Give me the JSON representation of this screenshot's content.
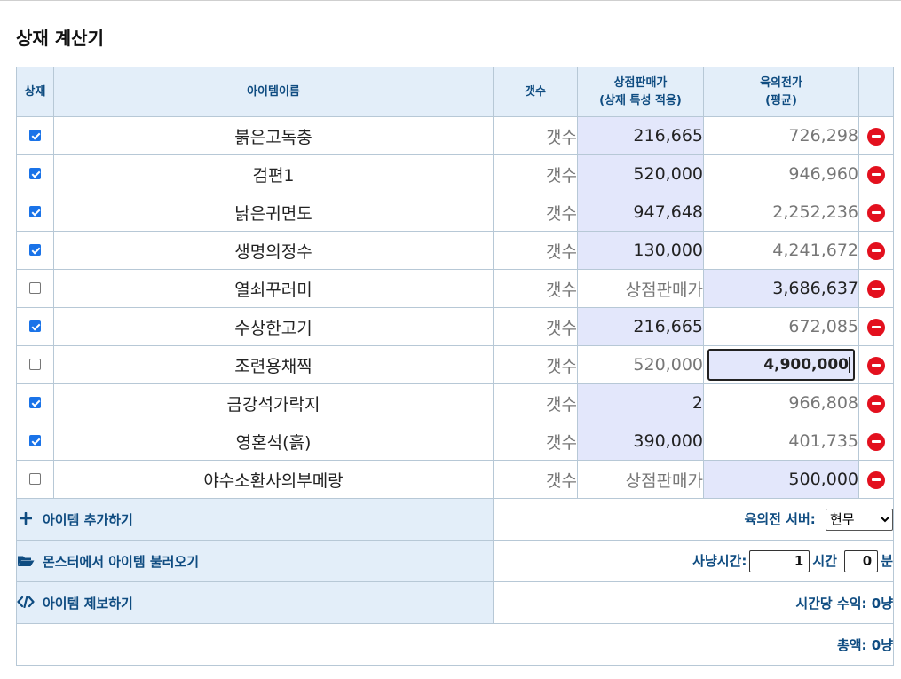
{
  "title": "상재 계산기",
  "headers": {
    "check": "상재",
    "name": "아이템이름",
    "qty": "갯수",
    "shop_line1": "상점판매가",
    "shop_line2": "(상재 특성 적용)",
    "market_line1": "육의전가",
    "market_line2": "(평균)"
  },
  "rows": [
    {
      "checked": true,
      "name": "붉은고독충",
      "qty_placeholder": "갯수",
      "shop": "216,665",
      "market": "726,298",
      "active": "shop"
    },
    {
      "checked": true,
      "name": "검편1",
      "qty_placeholder": "갯수",
      "shop": "520,000",
      "market": "946,960",
      "active": "shop"
    },
    {
      "checked": true,
      "name": "낡은귀면도",
      "qty_placeholder": "갯수",
      "shop": "947,648",
      "market": "2,252,236",
      "active": "shop"
    },
    {
      "checked": true,
      "name": "생명의정수",
      "qty_placeholder": "갯수",
      "shop": "130,000",
      "market": "4,241,672",
      "active": "shop"
    },
    {
      "checked": false,
      "name": "열쇠꾸러미",
      "qty_placeholder": "갯수",
      "shop": "상점판매가",
      "market": "3,686,637",
      "active": "market"
    },
    {
      "checked": true,
      "name": "수상한고기",
      "qty_placeholder": "갯수",
      "shop": "216,665",
      "market": "672,085",
      "active": "shop"
    },
    {
      "checked": false,
      "name": "조련용채찍",
      "qty_placeholder": "갯수",
      "shop": "520,000",
      "market": "4,900,000",
      "active": "market"
    },
    {
      "checked": true,
      "name": "금강석가락지",
      "qty_placeholder": "갯수",
      "shop": "2",
      "market": "966,808",
      "active": "shop"
    },
    {
      "checked": true,
      "name": "영혼석(흙)",
      "qty_placeholder": "갯수",
      "shop": "390,000",
      "market": "401,735",
      "active": "shop"
    },
    {
      "checked": false,
      "name": "야수소환사의부메랑",
      "qty_placeholder": "갯수",
      "shop": "상점판매가",
      "market": "500,000",
      "active": "market"
    }
  ],
  "actions": {
    "add": "아이템 추가하기",
    "load": "몬스터에서 아이템 불러오기",
    "report": "아이템 제보하기"
  },
  "server": {
    "label": "육의전 서버:",
    "selected": "현무"
  },
  "hunt": {
    "label": "사냥시간:",
    "hours": "1",
    "hours_unit": "시간",
    "minutes": "0",
    "minutes_unit": "분"
  },
  "hourly": "시간당 수익: 0냥",
  "total": "총액: 0냥",
  "icons": {
    "add": "plus-icon",
    "load": "folder-open-icon",
    "report": "code-icon",
    "remove": "remove-circle-icon"
  },
  "colors": {
    "accent": "#0f4c81",
    "header_bg": "#e3eef9",
    "highlight_bg": "#e3e7fb",
    "remove": "#e3101e",
    "checkbox": "#1a73e8"
  }
}
